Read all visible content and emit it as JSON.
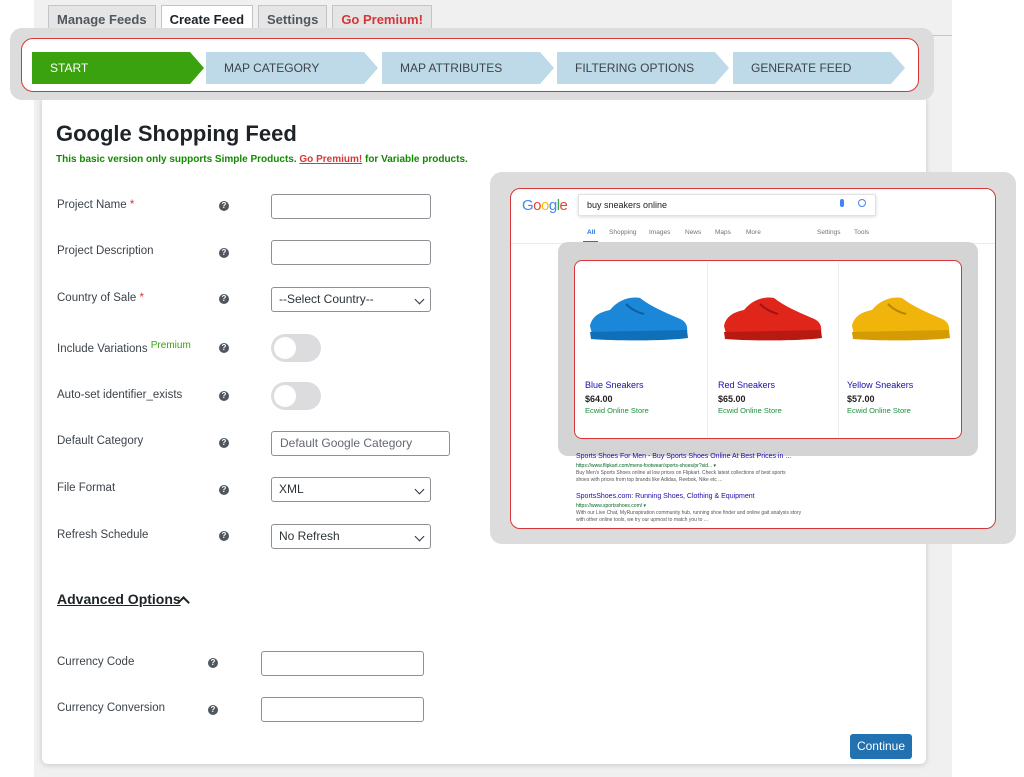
{
  "tabs": [
    {
      "label": "Manage Feeds"
    },
    {
      "label": "Create Feed"
    },
    {
      "label": "Settings"
    },
    {
      "label": "Go Premium!"
    }
  ],
  "steps": [
    "START",
    "MAP CATEGORY",
    "MAP ATTRIBUTES",
    "FILTERING OPTIONS",
    "GENERATE FEED"
  ],
  "page": {
    "title": "Google Shopping Feed",
    "notice_pre": "This basic version only supports Simple Products.",
    "notice_link": "Go Premium!",
    "notice_post": "for Variable products."
  },
  "form": {
    "help_glyph": "?",
    "required_mark": "*",
    "project_name": {
      "label": "Project Name",
      "value": ""
    },
    "project_description": {
      "label": "Project Description",
      "value": ""
    },
    "country_of_sale": {
      "label": "Country of Sale",
      "value": "--Select Country--"
    },
    "include_variations": {
      "label": "Include Variations",
      "badge": "Premium",
      "on": false
    },
    "auto_identifier": {
      "label": "Auto-set identifier_exists",
      "on": false
    },
    "default_category": {
      "label": "Default Category",
      "placeholder": "Default Google Category"
    },
    "file_format": {
      "label": "File Format",
      "value": "XML"
    },
    "refresh_schedule": {
      "label": "Refresh Schedule",
      "value": "No Refresh"
    },
    "advanced_options": "Advanced Options",
    "currency_code": {
      "label": "Currency Code",
      "value": ""
    },
    "currency_conversion": {
      "label": "Currency Conversion",
      "value": ""
    },
    "continue_label": "Continue"
  },
  "google": {
    "logo": [
      "G",
      "o",
      "o",
      "g",
      "l",
      "e"
    ],
    "logo_colors": [
      "#4285f4",
      "#ea4335",
      "#fbbc05",
      "#4285f4",
      "#34a853",
      "#ea4335"
    ],
    "query": "buy sneakers online",
    "nav": [
      "All",
      "Shopping",
      "Images",
      "News",
      "Maps",
      "More",
      "Settings",
      "Tools"
    ],
    "products": [
      {
        "name": "Blue Sneakers",
        "price": "$64.00",
        "store": "Ecwid Online Store",
        "color": "#1a87d8"
      },
      {
        "name": "Red Sneakers",
        "price": "$65.00",
        "store": "Ecwid Online Store",
        "color": "#e0251b"
      },
      {
        "name": "Yellow Sneakers",
        "price": "$57.00",
        "store": "Ecwid Online Store",
        "color": "#f0b40a"
      }
    ],
    "results": [
      {
        "title": "Sports Shoes For Men - Buy Sports Shoes Online At Best Prices in ...",
        "url": "https://www.flipkart.com/mens-footwear/sports-shoes/pr?sid... ▾",
        "snippet1": "Buy Men's Sports Shoes online at low prices on Flipkart. Check latest collections of best sports",
        "snippet2": "shoes with prices from top brands like Adidas, Reebok, Nike etc ..."
      },
      {
        "title": "SportsShoes.com: Running Shoes, Clothing & Equipment",
        "url": "https://www.sportsshoes.com/ ▾",
        "snippet1": "With our Live Chat, MyRunspiration community hub, running shoe finder and online gait analysis story",
        "snippet2": "with other online tools, we try our upmost to match you to ..."
      }
    ]
  }
}
